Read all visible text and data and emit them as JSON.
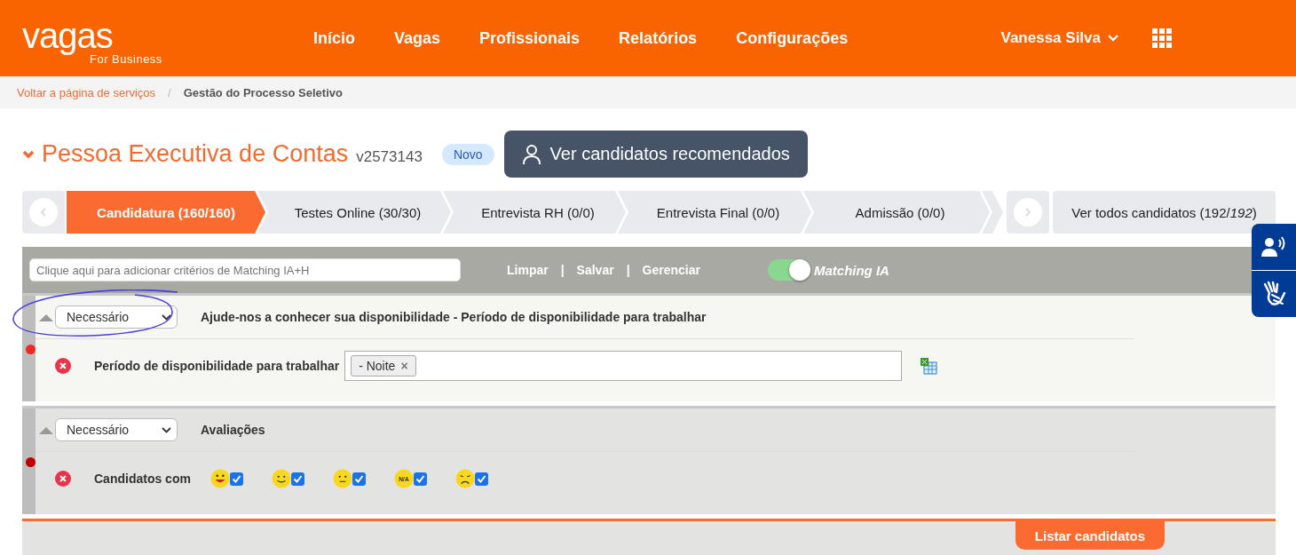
{
  "header": {
    "logo": {
      "name": "vagas",
      "tagline": "For Business"
    },
    "nav": [
      {
        "label": "Início"
      },
      {
        "label": "Vagas"
      },
      {
        "label": "Profissionais"
      },
      {
        "label": "Relatórios"
      },
      {
        "label": "Configurações"
      }
    ],
    "user": "Vanessa Silva"
  },
  "breadcrumb": [
    {
      "label": "Voltar a página de serviços",
      "kind": "link"
    },
    {
      "label": "/",
      "kind": "separator"
    },
    {
      "label": "Gestão do Processo Seletivo",
      "kind": "current"
    }
  ],
  "job": {
    "title": "Pessoa Executiva de Contas",
    "code": "v2573143",
    "badge": "Novo",
    "recommended_button": "Ver candidatos recomendados"
  },
  "stages": [
    {
      "label": "Candidatura (160/160)",
      "selected": true
    },
    {
      "label": "Testes Online (30/30)",
      "selected": false
    },
    {
      "label": "Entrevista RH (0/0)",
      "selected": false
    },
    {
      "label": "Entrevista Final (0/0)",
      "selected": false
    },
    {
      "label": "Admissão (0/0)",
      "selected": false
    }
  ],
  "all_candidates": "Ver todos candidatos (192/*192*)",
  "toolbar": {
    "search_placeholder": "Clique aqui para adicionar critérios de Matching IA+H",
    "links": [
      "Limpar",
      "Salvar",
      "Gerenciar"
    ],
    "separators": [
      "|",
      "|"
    ],
    "toggle": {
      "label": "Matching IA",
      "on": true
    }
  },
  "criteria": [
    {
      "priority": "Necessário",
      "title": "Ajude-nos a conhecer sua disponibilidade - Período de disponibilidade para trabalhar",
      "color": "#ee2a24",
      "highlighted": true,
      "rows": [
        {
          "kind": "tags",
          "label": "Período de disponibilidade para trabalhar",
          "tags": [
            "- Noite"
          ],
          "tag_remove": "×"
        }
      ]
    },
    {
      "priority": "Necessário",
      "title": "Avaliações",
      "color": "#c00000",
      "highlighted": false,
      "rows": [
        {
          "kind": "ratings",
          "label": "Candidatos com",
          "options": [
            {
              "kind": "grin",
              "checked": true
            },
            {
              "kind": "smile",
              "checked": true
            },
            {
              "kind": "neutral",
              "checked": true
            },
            {
              "kind": "na",
              "text": "N/A",
              "checked": true
            },
            {
              "kind": "sad",
              "checked": true
            }
          ]
        }
      ]
    }
  ],
  "list_button": "Listar candidatos"
}
